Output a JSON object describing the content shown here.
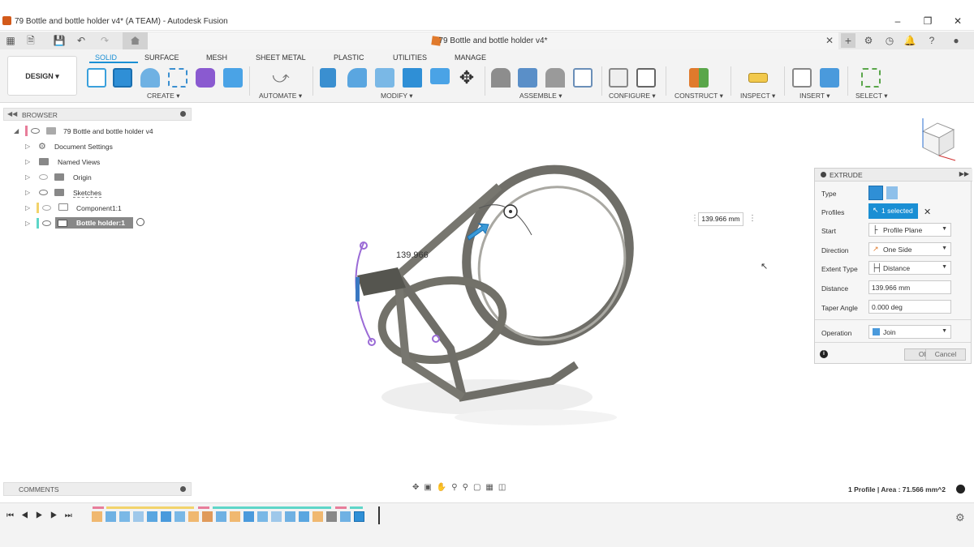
{
  "window": {
    "title": "79 Bottle and bottle holder v4* (A TEAM) - Autodesk Fusion"
  },
  "doc_tab": {
    "title": "79 Bottle and bottle holder v4*"
  },
  "workspace": {
    "label": "DESIGN"
  },
  "ribbon_tabs": [
    "SOLID",
    "SURFACE",
    "MESH",
    "SHEET METAL",
    "PLASTIC",
    "UTILITIES",
    "MANAGE"
  ],
  "groups": {
    "create": "CREATE",
    "automate": "AUTOMATE",
    "modify": "MODIFY",
    "assemble": "ASSEMBLE",
    "configure": "CONFIGURE",
    "construct": "CONSTRUCT",
    "inspect": "INSPECT",
    "insert": "INSERT",
    "select": "SELECT"
  },
  "browser": {
    "title": "BROWSER",
    "root": "79 Bottle and bottle holder v4",
    "items": [
      "Document Settings",
      "Named Views",
      "Origin",
      "Sketches",
      "Component1:1",
      "Bottle holder:1"
    ]
  },
  "comments": {
    "title": "COMMENTS"
  },
  "viewport": {
    "dimension_label": "139.966",
    "dimension_box": "139.966 mm",
    "status": "1 Profile | Area : 71.566 mm^2"
  },
  "extrude": {
    "title": "EXTRUDE",
    "type_label": "Type",
    "profiles_label": "Profiles",
    "profiles_value": "1 selected",
    "start_label": "Start",
    "start_value": "Profile Plane",
    "direction_label": "Direction",
    "direction_value": "One Side",
    "extent_label": "Extent Type",
    "extent_value": "Distance",
    "distance_label": "Distance",
    "distance_value": "139.966 mm",
    "taper_label": "Taper Angle",
    "taper_value": "0.000 deg",
    "operation_label": "Operation",
    "operation_value": "Join",
    "ok": "OK",
    "cancel": "Cancel"
  },
  "colors": {
    "accent": "#1a8fd4",
    "model": "#6f6e68",
    "sketch": "#9a6ad6"
  }
}
